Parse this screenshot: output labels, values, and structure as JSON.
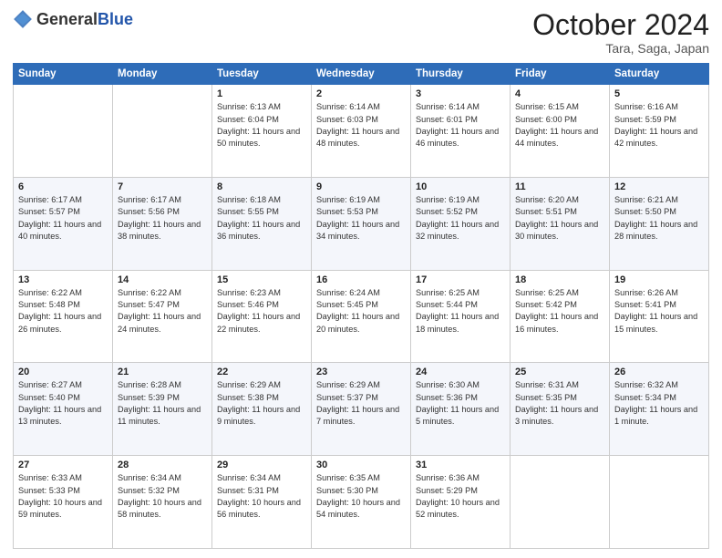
{
  "header": {
    "logo_general": "General",
    "logo_blue": "Blue",
    "month_title": "October 2024",
    "location": "Tara, Saga, Japan"
  },
  "days_of_week": [
    "Sunday",
    "Monday",
    "Tuesday",
    "Wednesday",
    "Thursday",
    "Friday",
    "Saturday"
  ],
  "weeks": [
    [
      {
        "day": "",
        "info": ""
      },
      {
        "day": "",
        "info": ""
      },
      {
        "day": "1",
        "info": "Sunrise: 6:13 AM\nSunset: 6:04 PM\nDaylight: 11 hours and 50 minutes."
      },
      {
        "day": "2",
        "info": "Sunrise: 6:14 AM\nSunset: 6:03 PM\nDaylight: 11 hours and 48 minutes."
      },
      {
        "day": "3",
        "info": "Sunrise: 6:14 AM\nSunset: 6:01 PM\nDaylight: 11 hours and 46 minutes."
      },
      {
        "day": "4",
        "info": "Sunrise: 6:15 AM\nSunset: 6:00 PM\nDaylight: 11 hours and 44 minutes."
      },
      {
        "day": "5",
        "info": "Sunrise: 6:16 AM\nSunset: 5:59 PM\nDaylight: 11 hours and 42 minutes."
      }
    ],
    [
      {
        "day": "6",
        "info": "Sunrise: 6:17 AM\nSunset: 5:57 PM\nDaylight: 11 hours and 40 minutes."
      },
      {
        "day": "7",
        "info": "Sunrise: 6:17 AM\nSunset: 5:56 PM\nDaylight: 11 hours and 38 minutes."
      },
      {
        "day": "8",
        "info": "Sunrise: 6:18 AM\nSunset: 5:55 PM\nDaylight: 11 hours and 36 minutes."
      },
      {
        "day": "9",
        "info": "Sunrise: 6:19 AM\nSunset: 5:53 PM\nDaylight: 11 hours and 34 minutes."
      },
      {
        "day": "10",
        "info": "Sunrise: 6:19 AM\nSunset: 5:52 PM\nDaylight: 11 hours and 32 minutes."
      },
      {
        "day": "11",
        "info": "Sunrise: 6:20 AM\nSunset: 5:51 PM\nDaylight: 11 hours and 30 minutes."
      },
      {
        "day": "12",
        "info": "Sunrise: 6:21 AM\nSunset: 5:50 PM\nDaylight: 11 hours and 28 minutes."
      }
    ],
    [
      {
        "day": "13",
        "info": "Sunrise: 6:22 AM\nSunset: 5:48 PM\nDaylight: 11 hours and 26 minutes."
      },
      {
        "day": "14",
        "info": "Sunrise: 6:22 AM\nSunset: 5:47 PM\nDaylight: 11 hours and 24 minutes."
      },
      {
        "day": "15",
        "info": "Sunrise: 6:23 AM\nSunset: 5:46 PM\nDaylight: 11 hours and 22 minutes."
      },
      {
        "day": "16",
        "info": "Sunrise: 6:24 AM\nSunset: 5:45 PM\nDaylight: 11 hours and 20 minutes."
      },
      {
        "day": "17",
        "info": "Sunrise: 6:25 AM\nSunset: 5:44 PM\nDaylight: 11 hours and 18 minutes."
      },
      {
        "day": "18",
        "info": "Sunrise: 6:25 AM\nSunset: 5:42 PM\nDaylight: 11 hours and 16 minutes."
      },
      {
        "day": "19",
        "info": "Sunrise: 6:26 AM\nSunset: 5:41 PM\nDaylight: 11 hours and 15 minutes."
      }
    ],
    [
      {
        "day": "20",
        "info": "Sunrise: 6:27 AM\nSunset: 5:40 PM\nDaylight: 11 hours and 13 minutes."
      },
      {
        "day": "21",
        "info": "Sunrise: 6:28 AM\nSunset: 5:39 PM\nDaylight: 11 hours and 11 minutes."
      },
      {
        "day": "22",
        "info": "Sunrise: 6:29 AM\nSunset: 5:38 PM\nDaylight: 11 hours and 9 minutes."
      },
      {
        "day": "23",
        "info": "Sunrise: 6:29 AM\nSunset: 5:37 PM\nDaylight: 11 hours and 7 minutes."
      },
      {
        "day": "24",
        "info": "Sunrise: 6:30 AM\nSunset: 5:36 PM\nDaylight: 11 hours and 5 minutes."
      },
      {
        "day": "25",
        "info": "Sunrise: 6:31 AM\nSunset: 5:35 PM\nDaylight: 11 hours and 3 minutes."
      },
      {
        "day": "26",
        "info": "Sunrise: 6:32 AM\nSunset: 5:34 PM\nDaylight: 11 hours and 1 minute."
      }
    ],
    [
      {
        "day": "27",
        "info": "Sunrise: 6:33 AM\nSunset: 5:33 PM\nDaylight: 10 hours and 59 minutes."
      },
      {
        "day": "28",
        "info": "Sunrise: 6:34 AM\nSunset: 5:32 PM\nDaylight: 10 hours and 58 minutes."
      },
      {
        "day": "29",
        "info": "Sunrise: 6:34 AM\nSunset: 5:31 PM\nDaylight: 10 hours and 56 minutes."
      },
      {
        "day": "30",
        "info": "Sunrise: 6:35 AM\nSunset: 5:30 PM\nDaylight: 10 hours and 54 minutes."
      },
      {
        "day": "31",
        "info": "Sunrise: 6:36 AM\nSunset: 5:29 PM\nDaylight: 10 hours and 52 minutes."
      },
      {
        "day": "",
        "info": ""
      },
      {
        "day": "",
        "info": ""
      }
    ]
  ]
}
